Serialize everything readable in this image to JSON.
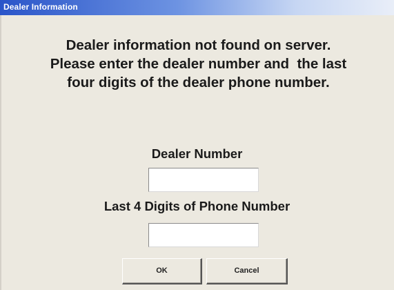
{
  "window": {
    "title": "Dealer Information"
  },
  "message": {
    "line1": "Dealer information not found on server.",
    "line2": "Please enter the dealer number and  the last",
    "line3": "four digits of the dealer phone number."
  },
  "form": {
    "dealer_number_label": "Dealer Number",
    "dealer_number_value": "",
    "phone_digits_label": "Last 4 Digits of Phone Number",
    "phone_digits_value": ""
  },
  "buttons": {
    "ok_label": "OK",
    "cancel_label": "Cancel"
  },
  "colors": {
    "titlebar_start": "#2a55c9",
    "titlebar_end": "#e9eef8",
    "background": "#ece9e0"
  }
}
